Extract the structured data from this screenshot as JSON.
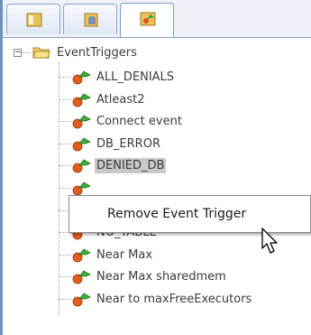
{
  "tabs": [
    {
      "name": "tab-explorer",
      "icon": "folder-tree-icon"
    },
    {
      "name": "tab-database",
      "icon": "database-icon"
    },
    {
      "name": "tab-triggers",
      "icon": "event-trigger-icon",
      "active": true
    }
  ],
  "tree": {
    "root": {
      "label": "EventTriggers",
      "expanded": true
    },
    "items": [
      {
        "label": "ALL_DENIALS"
      },
      {
        "label": "Atleast2"
      },
      {
        "label": "Connect event"
      },
      {
        "label": "DB_ERROR"
      },
      {
        "label": "DENIED_DB",
        "selected": true
      },
      {
        "label": ""
      },
      {
        "label": ""
      },
      {
        "label": "NO_TABLE"
      },
      {
        "label": "Near Max"
      },
      {
        "label": "Near Max sharedmem"
      },
      {
        "label": "Near to maxFreeExecutors"
      }
    ]
  },
  "context_menu": {
    "items": [
      {
        "label": "Remove Event Trigger"
      }
    ]
  }
}
